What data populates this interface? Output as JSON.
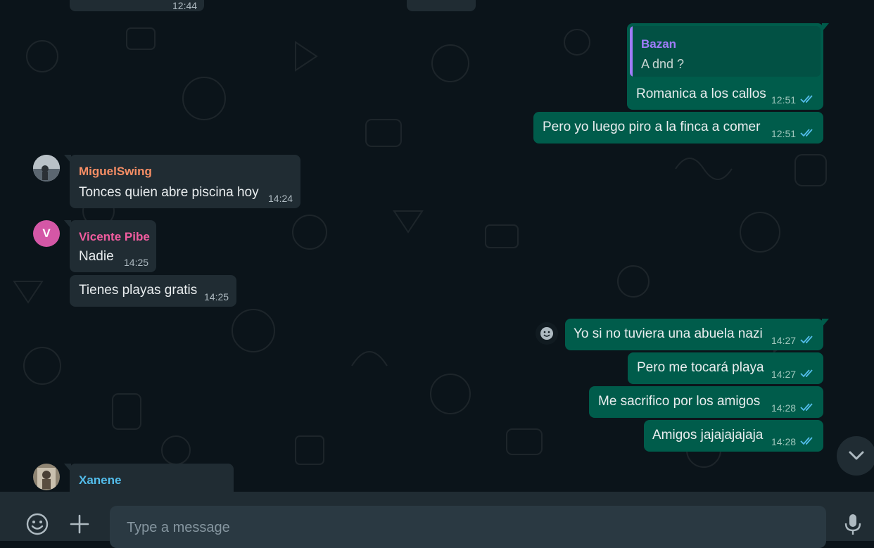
{
  "messages": {
    "top_partial_time": "12:44",
    "m1": {
      "quote_sender": "Bazan",
      "quote_text": "A dnd ?",
      "text": "Romanica a los callos",
      "time": "12:51"
    },
    "m2": {
      "text": "Pero yo luego piro a la finca a comer",
      "time": "12:51"
    },
    "m3": {
      "sender": "MiguelSwing",
      "text": "Tonces quien abre piscina hoy",
      "time": "14:24"
    },
    "m4": {
      "avatar_letter": "V",
      "sender": "Vicente Pibe",
      "text": "Nadie",
      "time": "14:25"
    },
    "m5": {
      "text": "Tienes playas gratis",
      "time": "14:25"
    },
    "m6": {
      "text": "Yo si no tuviera una abuela nazi",
      "time": "14:27"
    },
    "m7": {
      "text": "Pero me tocará playa",
      "time": "14:27"
    },
    "m8": {
      "text": "Me sacrifico por los amigos",
      "time": "14:28"
    },
    "m9": {
      "text": "Amigos jajajajajaja",
      "time": "14:28"
    },
    "m10": {
      "sender": "Xanene"
    }
  },
  "composer": {
    "placeholder": "Type a message"
  },
  "colors": {
    "background": "#0b141a",
    "incoming_bubble": "#202c33",
    "outgoing_bubble": "#005c4b",
    "read_ticks": "#53bdeb",
    "sender_miguel": "#f78e65",
    "sender_vicente": "#f15c9f",
    "sender_xanene": "#53bdeb",
    "sender_bazan": "#a07cfa"
  },
  "icons": [
    "smiley-icon",
    "plus-icon",
    "mic-icon",
    "chevron-down-icon",
    "double-check-icon"
  ]
}
